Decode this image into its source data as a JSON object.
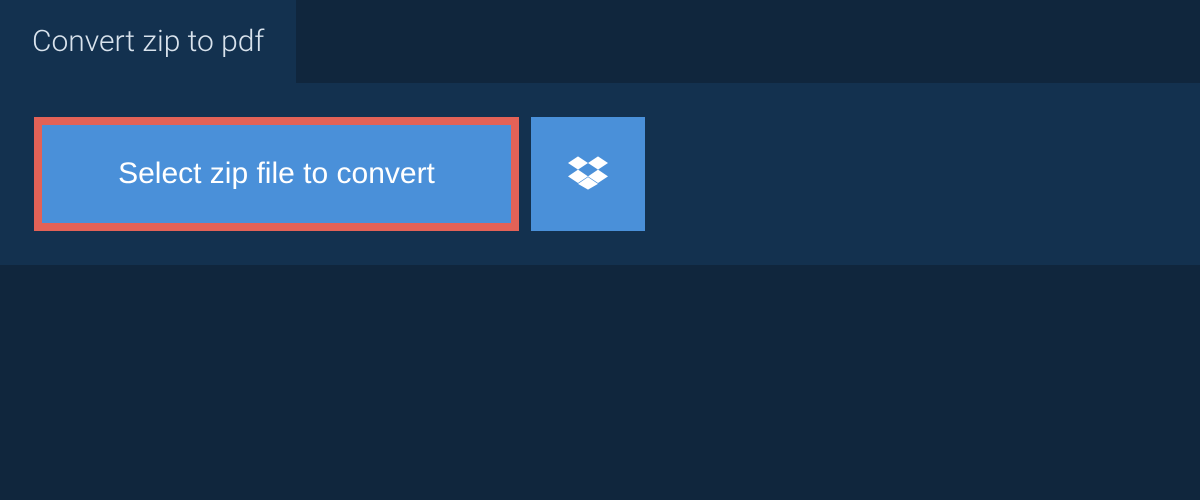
{
  "tab": {
    "title": "Convert zip to pdf"
  },
  "actions": {
    "select_label": "Select zip file to convert"
  }
}
